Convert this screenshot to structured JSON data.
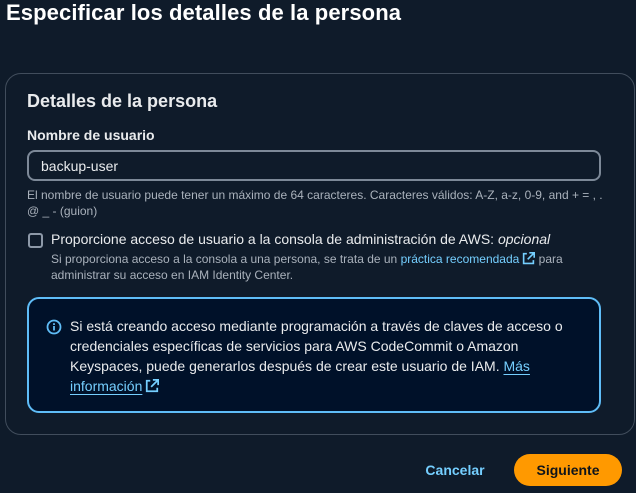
{
  "page": {
    "title": "Especificar los detalles de la persona"
  },
  "details": {
    "title": "Detalles de la persona",
    "username_label": "Nombre de usuario",
    "username_value": "backup-user",
    "username_constraint": "El nombre de usuario puede tener un máximo de 64 caracteres. Caracteres válidos: A-Z, a-z, 0-9, and + = , . @ _ - (guion)"
  },
  "console_access": {
    "checked": false,
    "label": "Proporcione acceso de usuario a la consola de administración de AWS:",
    "optional": "opcional",
    "desc_before": "Si proporciona acceso a la consola a una persona, se trata de un",
    "desc_link": "práctica recomendada",
    "desc_after": "para administrar su acceso en IAM Identity Center."
  },
  "info_alert": {
    "text": "Si está creando acceso mediante programación a través de claves de acceso o credenciales específicas de servicios para AWS CodeCommit o Amazon Keyspaces, puede generarlos después de crear este usuario de IAM.",
    "link": "Más información"
  },
  "actions": {
    "cancel_label": "Cancelar",
    "next_label": "Siguiente"
  },
  "icons": {
    "info": "info-icon",
    "external_link": "external-link-icon"
  },
  "colors": {
    "background": "#0f1b2a",
    "link": "#75cfff",
    "primary_button": "#ff9900",
    "info_border": "#5fbdf7"
  }
}
